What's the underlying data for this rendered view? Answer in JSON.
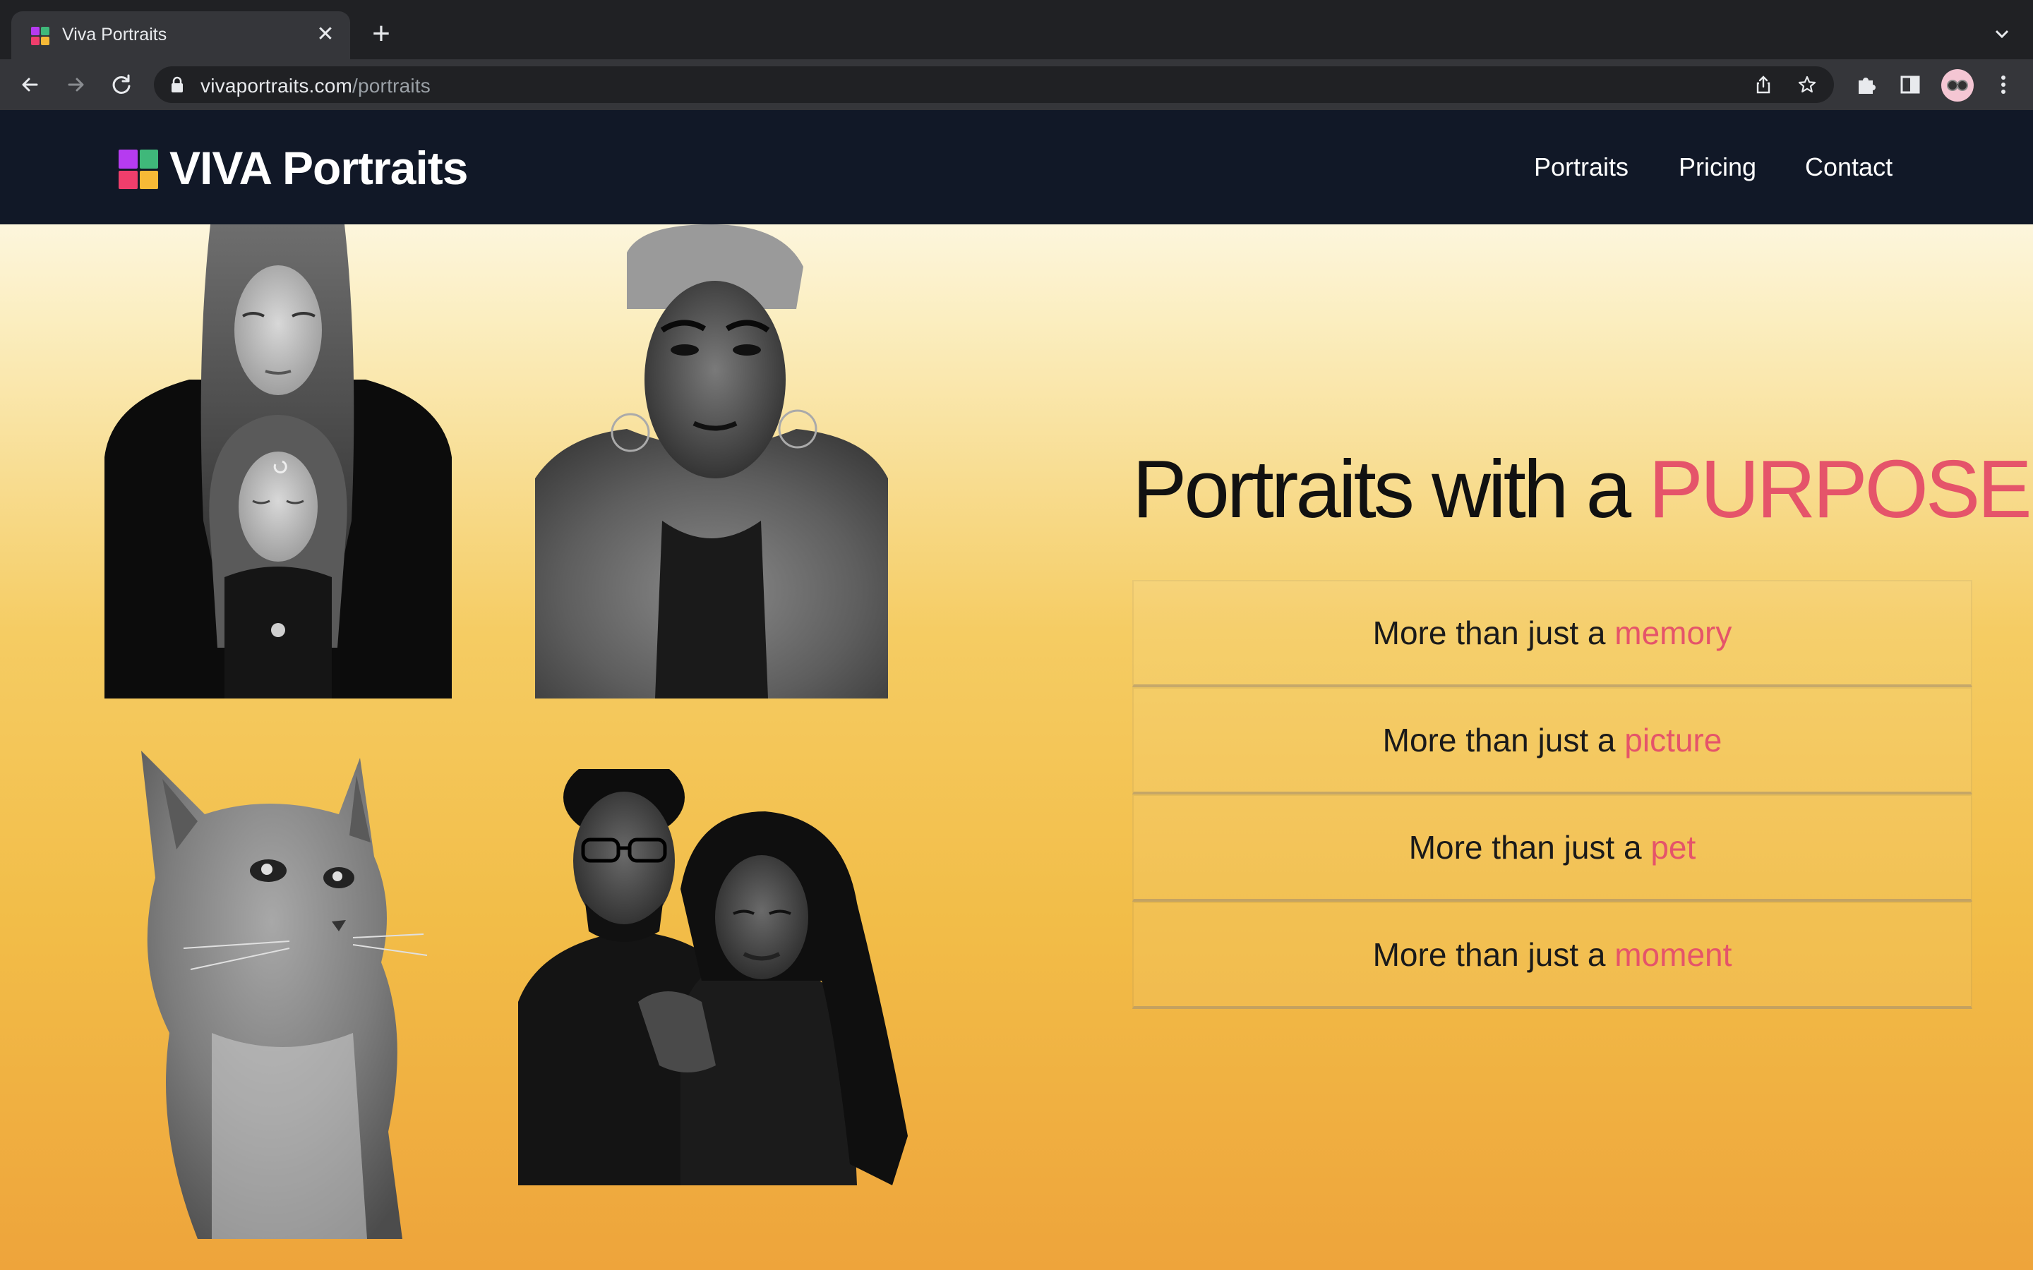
{
  "browser": {
    "tab_title": "Viva Portraits",
    "url_domain": "vivaportraits.com",
    "url_path": "/portraits",
    "new_tab_glyph": "+",
    "close_glyph": "✕"
  },
  "colors": {
    "logo": [
      "#b63bf0",
      "#3fb87a",
      "#ef3e6c",
      "#f6b936"
    ],
    "accent": "#e5546a",
    "navbar_bg": "#111827"
  },
  "site": {
    "brand": "VIVA Portraits",
    "nav": [
      "Portraits",
      "Pricing",
      "Contact"
    ]
  },
  "hero": {
    "headline_prefix": "Portraits with a ",
    "headline_accent": "PURPOSE",
    "cards": [
      {
        "prefix": "More than just a ",
        "accent": "memory"
      },
      {
        "prefix": "More than just a ",
        "accent": "picture"
      },
      {
        "prefix": "More than just a ",
        "accent": "pet"
      },
      {
        "prefix": "More than just a ",
        "accent": "moment"
      }
    ]
  },
  "images": [
    {
      "name": "portrait-mother-daughter",
      "alt": "woman and girl portrait"
    },
    {
      "name": "portrait-fur-coat",
      "alt": "person in fur coat"
    },
    {
      "name": "portrait-cat",
      "alt": "cat portrait"
    },
    {
      "name": "portrait-couple",
      "alt": "couple portrait"
    }
  ]
}
